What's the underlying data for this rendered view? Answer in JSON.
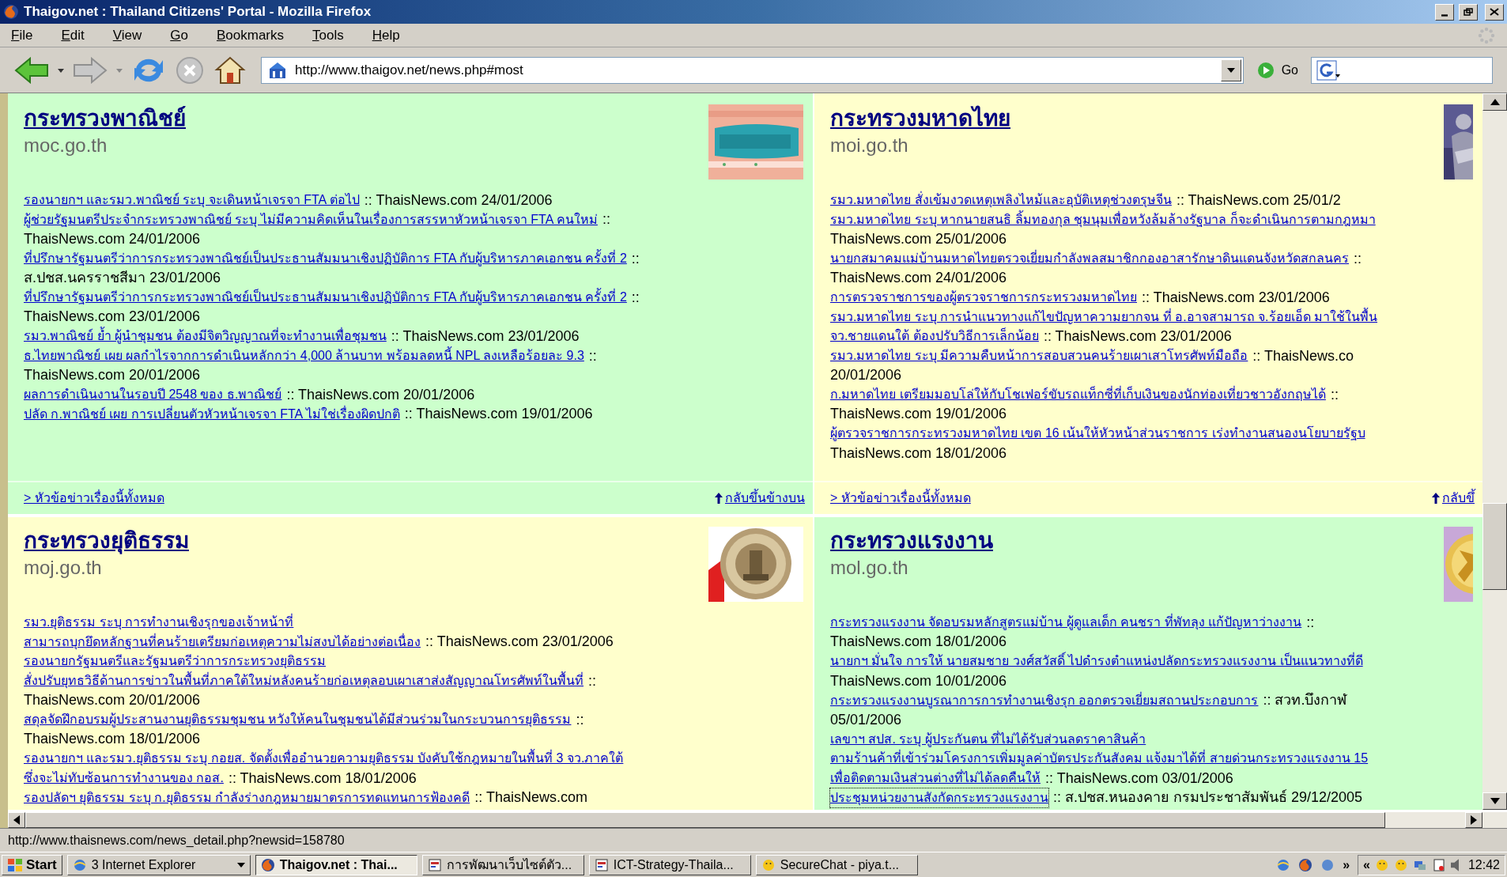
{
  "window": {
    "title": "Thaigov.net : Thailand Citizens' Portal - Mozilla Firefox"
  },
  "menu": [
    "File",
    "Edit",
    "View",
    "Go",
    "Bookmarks",
    "Tools",
    "Help"
  ],
  "address": {
    "url": "http://www.thaigov.net/news.php#most",
    "go_label": "Go"
  },
  "panels": [
    {
      "heading": "กระทรวงพาณิชย์",
      "domain": "moc.go.th",
      "color": "#ccffcc",
      "items": [
        {
          "focused": false,
          "lines": [
            [
              {
                "kind": "link",
                "text": "รองนายกฯ และรมว.พาณิชย์ ระบุ จะเดินหน้าเจรจา FTA ต่อไป"
              },
              {
                "kind": "text",
                "text": ":: ThaisNews.com 24/01/2006"
              }
            ]
          ]
        },
        {
          "focused": false,
          "lines": [
            [
              {
                "kind": "link",
                "text": "ผู้ช่วยรัฐมนตรีประจำกระทรวงพาณิชย์ ระบุ ไม่มีความคิดเห็นในเรื่องการสรรหาหัวหน้าเจรจา FTA คนใหม่"
              },
              {
                "kind": "text",
                "text": "::"
              }
            ],
            [
              {
                "kind": "text",
                "text": "ThaisNews.com 24/01/2006"
              }
            ]
          ]
        },
        {
          "focused": false,
          "lines": [
            [
              {
                "kind": "link",
                "text": "ที่ปรึกษารัฐมนตรีว่าการกระทรวงพาณิชย์เป็นประธานสัมมนาเชิงปฏิบัติการ FTA กับผู้บริหารภาคเอกชน ครั้งที่ 2"
              },
              {
                "kind": "text",
                "text": "::"
              }
            ],
            [
              {
                "kind": "text",
                "text": "ส.ปชส.นครราชสีมา 23/01/2006"
              }
            ]
          ]
        },
        {
          "focused": false,
          "lines": [
            [
              {
                "kind": "link",
                "text": "ที่ปรึกษารัฐมนตรีว่าการกระทรวงพาณิชย์เป็นประธานสัมมนาเชิงปฏิบัติการ FTA กับผู้บริหารภาคเอกชน ครั้งที่ 2"
              },
              {
                "kind": "text",
                "text": "::"
              }
            ],
            [
              {
                "kind": "text",
                "text": "ThaisNews.com 23/01/2006"
              }
            ]
          ]
        },
        {
          "focused": false,
          "lines": [
            [
              {
                "kind": "link",
                "text": "รมว.พาณิชย์ ย้ำ ผู้นำชุมชน ต้องมีจิตวิญญาณที่จะทำงานเพื่อชุมชน"
              },
              {
                "kind": "text",
                "text": ":: ThaisNews.com 23/01/2006"
              }
            ]
          ]
        },
        {
          "focused": false,
          "lines": [
            [
              {
                "kind": "link",
                "text": "ธ.ไทยพาณิชย์ เผย ผลกำไรจากการดำเนินหลักกว่า 4,000 ล้านบาท พร้อมลดหนี้ NPL ลงเหลือร้อยละ 9.3"
              },
              {
                "kind": "text",
                "text": "::"
              }
            ],
            [
              {
                "kind": "text",
                "text": "ThaisNews.com 20/01/2006"
              }
            ]
          ]
        },
        {
          "focused": false,
          "lines": [
            [
              {
                "kind": "link",
                "text": "ผลการดำเนินงานในรอบปี 2548 ของ ธ.พาณิชย์"
              },
              {
                "kind": "text",
                "text": ":: ThaisNews.com 20/01/2006"
              }
            ]
          ]
        },
        {
          "focused": false,
          "lines": [
            [
              {
                "kind": "link",
                "text": "ปลัด ก.พาณิชย์ เผย การเปลี่ยนตัวหัวหน้าเจรจา FTA ไม่ใช่เรื่องผิดปกติ"
              },
              {
                "kind": "text",
                "text": ":: ThaisNews.com 19/01/2006"
              }
            ]
          ]
        }
      ],
      "footer": {
        "all_link": "> หัวข้อข่าวเรื่องนี้ทั้งหมด",
        "top_link": "กลับขึ้นข้างบน"
      }
    },
    {
      "heading": "กระทรวงมหาดไทย",
      "domain": "moi.go.th",
      "color": "#ffffcc",
      "items": [
        {
          "focused": false,
          "lines": [
            [
              {
                "kind": "link",
                "text": "รมว.มหาดไทย สั่งเข้มงวดเหตุเพลิงไหม้และอุบัติเหตุช่วงตรุษจีน"
              },
              {
                "kind": "text",
                "text": ":: ThaisNews.com 25/01/2"
              }
            ]
          ]
        },
        {
          "focused": false,
          "lines": [
            [
              {
                "kind": "link",
                "text": "รมว.มหาดไทย ระบุ หากนายสนธิ ลิ้มทองกุล ชุมนุมเพื่อหวังล้มล้างรัฐบาล ก็จะดำเนินการตามกฎหมา"
              }
            ],
            [
              {
                "kind": "text",
                "text": "ThaisNews.com 25/01/2006"
              }
            ]
          ]
        },
        {
          "focused": false,
          "lines": [
            [
              {
                "kind": "link",
                "text": "นายกสมาคมแม่บ้านมหาดไทยตรวจเยี่ยมกำลังพลสมาชิกกองอาสารักษาดินแดนจังหวัดสกลนคร"
              },
              {
                "kind": "text",
                "text": "::"
              }
            ],
            [
              {
                "kind": "text",
                "text": "ThaisNews.com 24/01/2006"
              }
            ]
          ]
        },
        {
          "focused": false,
          "lines": [
            [
              {
                "kind": "link",
                "text": "การตรวจราชการของผู้ตรวจราชการกระทรวงมหาดไทย"
              },
              {
                "kind": "text",
                "text": ":: ThaisNews.com 23/01/2006"
              }
            ]
          ]
        },
        {
          "focused": false,
          "lines": [
            [
              {
                "kind": "link",
                "text": "รมว.มหาดไทย ระบุ การนำแนวทางแก้ไขปัญหาความยากจน ที่ อ.อาจสามารถ จ.ร้อยเอ็ด มาใช้ในพื้น"
              }
            ],
            [
              {
                "kind": "link",
                "text": "จว.ชายแดนใต้ ต้องปรับวิธีการเล็กน้อย"
              },
              {
                "kind": "text",
                "text": ":: ThaisNews.com 23/01/2006"
              }
            ]
          ]
        },
        {
          "focused": false,
          "lines": [
            [
              {
                "kind": "link",
                "text": "รมว.มหาดไทย ระบุ มีความคืบหน้าการสอบสวนคนร้ายเผาเสาโทรศัพท์มือถือ"
              },
              {
                "kind": "text",
                "text": ":: ThaisNews.co"
              }
            ],
            [
              {
                "kind": "text",
                "text": "20/01/2006"
              }
            ]
          ]
        },
        {
          "focused": false,
          "lines": [
            [
              {
                "kind": "link",
                "text": "ก.มหาดไทย เตรียมมอบโล่ให้กับโชเฟอร์ขับรถแท็กซี่ที่เก็บเงินของนักท่องเที่ยวชาวอังกฤษได้"
              },
              {
                "kind": "text",
                "text": "::"
              }
            ],
            [
              {
                "kind": "text",
                "text": "ThaisNews.com 19/01/2006"
              }
            ]
          ]
        },
        {
          "focused": false,
          "lines": [
            [
              {
                "kind": "link",
                "text": "ผู้ตรวจราชการกระทรวงมหาดไทย เขต 16 เน้นให้หัวหน้าส่วนราชการ เร่งทำงานสนองนโยบายรัฐบ"
              }
            ],
            [
              {
                "kind": "text",
                "text": "ThaisNews.com 18/01/2006"
              }
            ]
          ]
        }
      ],
      "footer": {
        "all_link": "> หัวข้อข่าวเรื่องนี้ทั้งหมด",
        "top_link": "กลับขึ้"
      }
    },
    {
      "heading": "กระทรวงยุติธรรม",
      "domain": "moj.go.th",
      "color": "#ffffcc",
      "items": [
        {
          "focused": false,
          "lines": [
            [
              {
                "kind": "link",
                "text": "รมว.ยุติธรรม ระบุ การทำงานเชิงรุกของเจ้าหน้าที่"
              }
            ],
            [
              {
                "kind": "link",
                "text": "สามารถบุกยึดหลักฐานที่คนร้ายเตรียมก่อเหตุความไม่สงบได้อย่างต่อเนื่อง"
              },
              {
                "kind": "text",
                "text": ":: ThaisNews.com 23/01/2006"
              }
            ]
          ]
        },
        {
          "focused": false,
          "lines": [
            [
              {
                "kind": "link",
                "text": "รองนายกรัฐมนตรีและรัฐมนตรีว่าการกระทรวงยุติธรรม"
              }
            ],
            [
              {
                "kind": "link",
                "text": "สั่งปรับยุทธวิธีด้านการข่าวในพื้นที่ภาคใต้ใหม่หลังคนร้ายก่อเหตุลอบเผาเสาส่งสัญญาณโทรศัพท์ในพื้นที่"
              },
              {
                "kind": "text",
                "text": "::"
              }
            ],
            [
              {
                "kind": "text",
                "text": "ThaisNews.com 20/01/2006"
              }
            ]
          ]
        },
        {
          "focused": false,
          "lines": [
            [
              {
                "kind": "link",
                "text": "สดุลจัดฝึกอบรมผู้ประสานงานยุติธรรมชุมชน หวังให้คนในชุมชนได้มีส่วนร่วมในกระบวนการยุติธรรม"
              },
              {
                "kind": "text",
                "text": "::"
              }
            ],
            [
              {
                "kind": "text",
                "text": "ThaisNews.com 18/01/2006"
              }
            ]
          ]
        },
        {
          "focused": false,
          "lines": [
            [
              {
                "kind": "link",
                "text": "รองนายกฯ และรมว.ยุติธรรม ระบุ กอยส. จัดตั้งเพื่ออำนวยความยุติธรรม บังคับใช้กฎหมายในพื้นที่ 3 จว.ภาคใต้"
              }
            ],
            [
              {
                "kind": "link",
                "text": "ซึ่งจะไม่ทับซ้อนการทำงานของ กอส."
              },
              {
                "kind": "text",
                "text": ":: ThaisNews.com 18/01/2006"
              }
            ]
          ]
        },
        {
          "focused": false,
          "lines": [
            [
              {
                "kind": "link",
                "text": "รองปลัดฯ ยุติธรรม ระบุ ก.ยุติธรรม กำลังร่างกฎหมายมาตรการทดแทนการฟ้องคดี"
              },
              {
                "kind": "text",
                "text": ":: ThaisNews.com"
              }
            ]
          ]
        }
      ]
    },
    {
      "heading": "กระทรวงแรงงาน",
      "domain": "mol.go.th",
      "color": "#ccffcc",
      "items": [
        {
          "focused": false,
          "lines": [
            [
              {
                "kind": "link",
                "text": "กระทรวงแรงงาน จัดอบรมหลักสูตรแม่บ้าน ผู้ดูแลเด็ก คนชรา ที่พัทลุง แก้ปัญหาว่างงาน"
              },
              {
                "kind": "text",
                "text": "::"
              }
            ],
            [
              {
                "kind": "text",
                "text": "ThaisNews.com 18/01/2006"
              }
            ]
          ]
        },
        {
          "focused": false,
          "lines": [
            [
              {
                "kind": "link",
                "text": "นายกฯ มั่นใจ การให้ นายสมชาย วงศ์สวัสดิ์ ไปดำรงตำแหน่งปลัดกระทรวงแรงงาน เป็นแนวทางที่ดี"
              }
            ],
            [
              {
                "kind": "text",
                "text": "ThaisNews.com 10/01/2006"
              }
            ]
          ]
        },
        {
          "focused": false,
          "lines": [
            [
              {
                "kind": "link",
                "text": "กระทรวงแรงงานบูรณาการการทำงานเชิงรุก ออกตรวจเยี่ยมสถานประกอบการ"
              },
              {
                "kind": "text",
                "text": ":: สวท.บึงกาฬ"
              }
            ],
            [
              {
                "kind": "text",
                "text": "05/01/2006"
              }
            ]
          ]
        },
        {
          "focused": false,
          "lines": [
            [
              {
                "kind": "link",
                "text": "เลขาฯ สปส. ระบุ ผู้ประกันตน ที่ไม่ได้รับส่วนลดราคาสินค้า"
              }
            ],
            [
              {
                "kind": "link",
                "text": "ตามร้านค้าที่เข้าร่วมโครงการเพิ่มมูลค่าบัตรประกันสังคม แจ้งมาได้ที่ สายด่วนกระทรวงแรงงาน 15"
              }
            ],
            [
              {
                "kind": "link",
                "text": "เพื่อติดตามเงินส่วนต่างที่ไม่ได้ลดคืนให้"
              },
              {
                "kind": "text",
                "text": ":: ThaisNews.com 03/01/2006"
              }
            ]
          ]
        },
        {
          "focused": true,
          "lines": [
            [
              {
                "kind": "link",
                "text": "ประชุมหน่วยงานสังกัดกระทรวงแรงงาน"
              },
              {
                "kind": "text",
                "text": ":: ส.ปชส.หนองคาย กรมประชาสัมพันธ์ 29/12/2005"
              }
            ]
          ]
        }
      ]
    }
  ],
  "status_bar": "http://www.thaisnews.com/news_detail.php?newsid=158780",
  "taskbar": {
    "start": "Start",
    "buttons": [
      {
        "kind": "ie",
        "label": "3 Internet Explorer",
        "selected": false
      },
      {
        "kind": "firefox",
        "label": "Thaigov.net : Thai...",
        "selected": true
      },
      {
        "kind": "document",
        "label": "การพัฒนาเว็บไซต์ตัว...",
        "selected": false
      },
      {
        "kind": "document",
        "label": "ICT-Strategy-Thaila...",
        "selected": false
      },
      {
        "kind": "chat",
        "label": "SecureChat - piya.t...",
        "selected": false
      }
    ],
    "quick_more": "»",
    "tray_expand": "«",
    "clock": "12:42"
  }
}
